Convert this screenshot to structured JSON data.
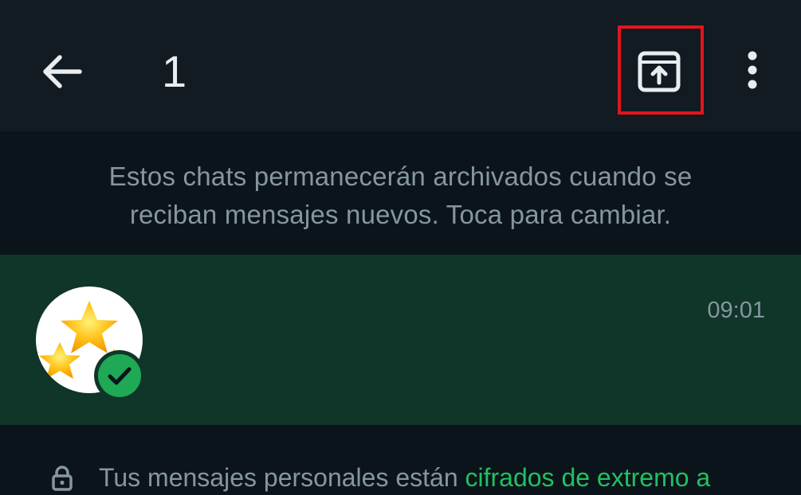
{
  "header": {
    "back_icon": "arrow-left-icon",
    "title": "1",
    "unarchive_icon": "unarchive-icon",
    "menu_icon": "more-vertical-icon",
    "highlight_color": "#e3141d"
  },
  "info_banner": {
    "line1": "Estos chats permanecerán archivados cuando se",
    "line2": "reciban mensajes nuevos. Toca para cambiar."
  },
  "chat_list": [
    {
      "time": "09:01",
      "avatar_icon": "stars-icon",
      "badge_icon": "check-badge-icon"
    }
  ],
  "footer": {
    "icon": "lock-icon",
    "text": "Tus mensajes personales están ",
    "link_text": "cifrados de extremo a"
  },
  "colors": {
    "header_bg": "#111b21",
    "page_bg": "#0b141a",
    "selected_row": "#103529",
    "accent": "#21c063",
    "muted_text": "#8696a0"
  }
}
